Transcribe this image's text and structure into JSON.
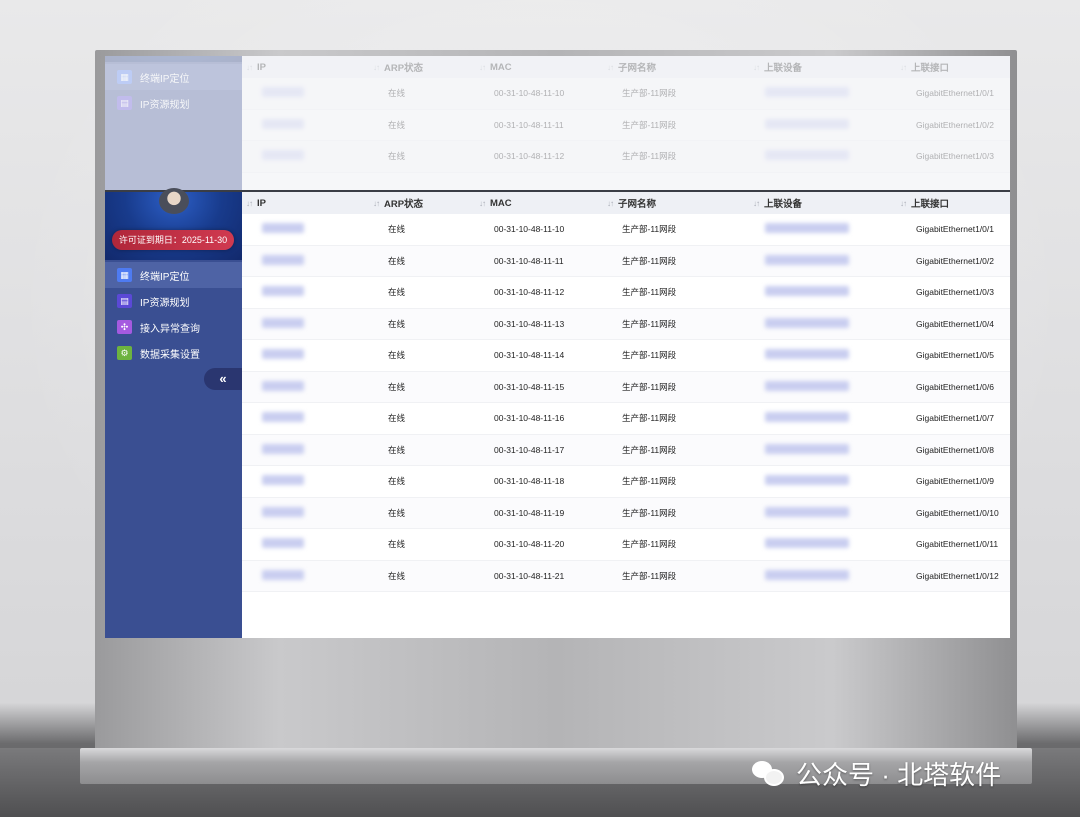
{
  "sidebar": {
    "license_text": "许可证到期日：2025-11-30",
    "menu": [
      {
        "label": "终端IP定位",
        "icon": "location-chart-icon",
        "color": "#4e7bf2",
        "active": true
      },
      {
        "label": "IP资源规划",
        "icon": "ip-plan-icon",
        "color": "#5b49d6",
        "active": false
      },
      {
        "label": "接入异常查询",
        "icon": "network-alert-icon",
        "color": "#a55ae0",
        "active": false
      },
      {
        "label": "数据采集设置",
        "icon": "gear-icon",
        "color": "#6db33f",
        "active": false
      }
    ],
    "collapse_label": "«"
  },
  "table": {
    "columns": [
      "IP",
      "ARP状态",
      "MAC",
      "子网名称",
      "上联设备",
      "上联接口"
    ],
    "sort_glyph": "↓↑",
    "rows": [
      {
        "arp": "在线",
        "mac": "00-31-10-48-11-10",
        "subnet": "生产部-11网段",
        "port": "GigabitEthernet1/0/1"
      },
      {
        "arp": "在线",
        "mac": "00-31-10-48-11-11",
        "subnet": "生产部-11网段",
        "port": "GigabitEthernet1/0/2"
      },
      {
        "arp": "在线",
        "mac": "00-31-10-48-11-12",
        "subnet": "生产部-11网段",
        "port": "GigabitEthernet1/0/3"
      },
      {
        "arp": "在线",
        "mac": "00-31-10-48-11-13",
        "subnet": "生产部-11网段",
        "port": "GigabitEthernet1/0/4"
      },
      {
        "arp": "在线",
        "mac": "00-31-10-48-11-14",
        "subnet": "生产部-11网段",
        "port": "GigabitEthernet1/0/5"
      },
      {
        "arp": "在线",
        "mac": "00-31-10-48-11-15",
        "subnet": "生产部-11网段",
        "port": "GigabitEthernet1/0/6"
      },
      {
        "arp": "在线",
        "mac": "00-31-10-48-11-16",
        "subnet": "生产部-11网段",
        "port": "GigabitEthernet1/0/7"
      },
      {
        "arp": "在线",
        "mac": "00-31-10-48-11-17",
        "subnet": "生产部-11网段",
        "port": "GigabitEthernet1/0/8"
      },
      {
        "arp": "在线",
        "mac": "00-31-10-48-11-18",
        "subnet": "生产部-11网段",
        "port": "GigabitEthernet1/0/9"
      },
      {
        "arp": "在线",
        "mac": "00-31-10-48-11-19",
        "subnet": "生产部-11网段",
        "port": "GigabitEthernet1/0/10"
      },
      {
        "arp": "在线",
        "mac": "00-31-10-48-11-20",
        "subnet": "生产部-11网段",
        "port": "GigabitEthernet1/0/11"
      },
      {
        "arp": "在线",
        "mac": "00-31-10-48-11-21",
        "subnet": "生产部-11网段",
        "port": "GigabitEthernet1/0/12"
      }
    ]
  },
  "watermark": {
    "text": "公众号 · 北塔软件",
    "icon": "wechat-icon"
  }
}
